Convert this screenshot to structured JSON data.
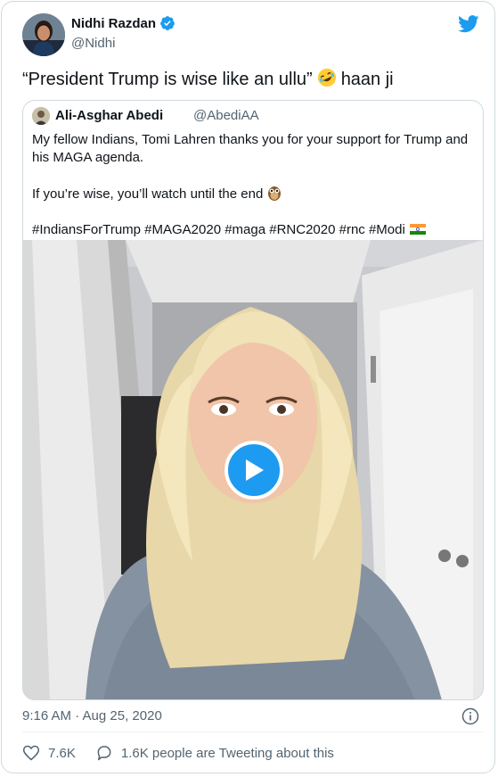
{
  "author": {
    "name": "Nidhi Razdan",
    "handle": "@Nidhi",
    "verified": true,
    "avatar": "avatar"
  },
  "tweet": {
    "text_before": "“President Trump is wise like an ullu”",
    "emoji": "rolling-on-floor-laughing-emoji",
    "text_after": "haan ji"
  },
  "quoted": {
    "name": "Ali-Asghar Abedi",
    "handle": "@AbediAA",
    "line1": "My fellow Indians, Tomi Lahren thanks you for your support for Trump and his MAGA agenda.",
    "line2": "If you’re wise, you’ll watch until the end",
    "line2_emoji": "owl-emoji",
    "hashtags": "#IndiansForTrump #MAGA2020 #maga #RNC2020 #rnc #Modi",
    "hashtags_emoji": "india-flag-emoji",
    "media": "video-thumbnail",
    "play_icon": "play-icon"
  },
  "meta": {
    "timestamp": "9:16 AM · Aug 25, 2020"
  },
  "actions": {
    "likes": "7.6K",
    "comments": "1.6K people are Tweeting about this"
  },
  "colors": {
    "accent": "#1d9bf0",
    "text": "#0f1419",
    "secondary": "#536471",
    "border": "#cfd9de"
  }
}
